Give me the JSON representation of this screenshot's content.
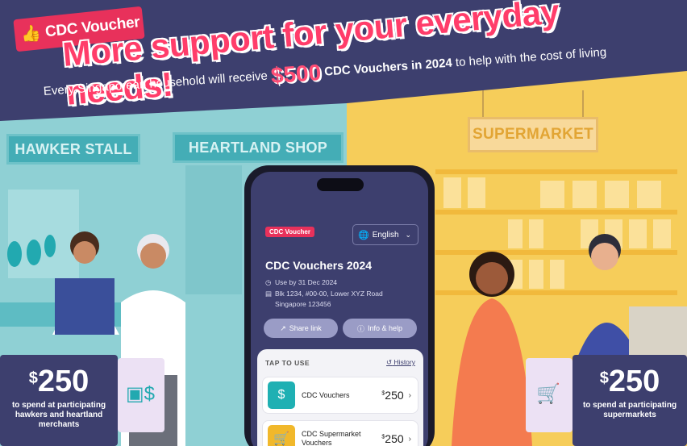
{
  "brand": {
    "label": "CDC Voucher",
    "icon": "thumbs-up-icon"
  },
  "headline": "More support for your everyday needs!",
  "subline": {
    "before": "Every Singaporean household will receive",
    "amount": "$500",
    "strong": "CDC Vouchers in 2024",
    "after": "to help with the cost of living"
  },
  "signs": {
    "hawker": "HAWKER STALL",
    "heartland": "HEARTLAND SHOP",
    "supermarket": "SUPERMARKET"
  },
  "left_offer": {
    "currency": "$",
    "amount": "250",
    "description": "to spend at participating hawkers and heartland merchants"
  },
  "right_offer": {
    "currency": "$",
    "amount": "250",
    "description": "to spend at participating supermarkets"
  },
  "phone": {
    "brand": "CDC Voucher",
    "language": "English",
    "title": "CDC Vouchers 2024",
    "use_by": "Use by 31 Dec 2024",
    "address_1": "Blk 1234, #00-00, Lower XYZ Road",
    "address_2": "Singapore 123456",
    "share_label": "Share link",
    "info_label": "Info & help",
    "tap_label": "TAP TO USE",
    "history_label": "History",
    "vouchers": [
      {
        "label": "CDC Vouchers",
        "currency": "$",
        "amount": "250",
        "icon": "voucher-icon"
      },
      {
        "label": "CDC Supermarket Vouchers",
        "currency": "$",
        "amount": "250",
        "icon": "cart-icon"
      }
    ]
  },
  "colors": {
    "navy": "#3d3f6e",
    "pink": "#e8315b",
    "teal": "#8fd0d4",
    "yellow": "#f6cd5a"
  }
}
